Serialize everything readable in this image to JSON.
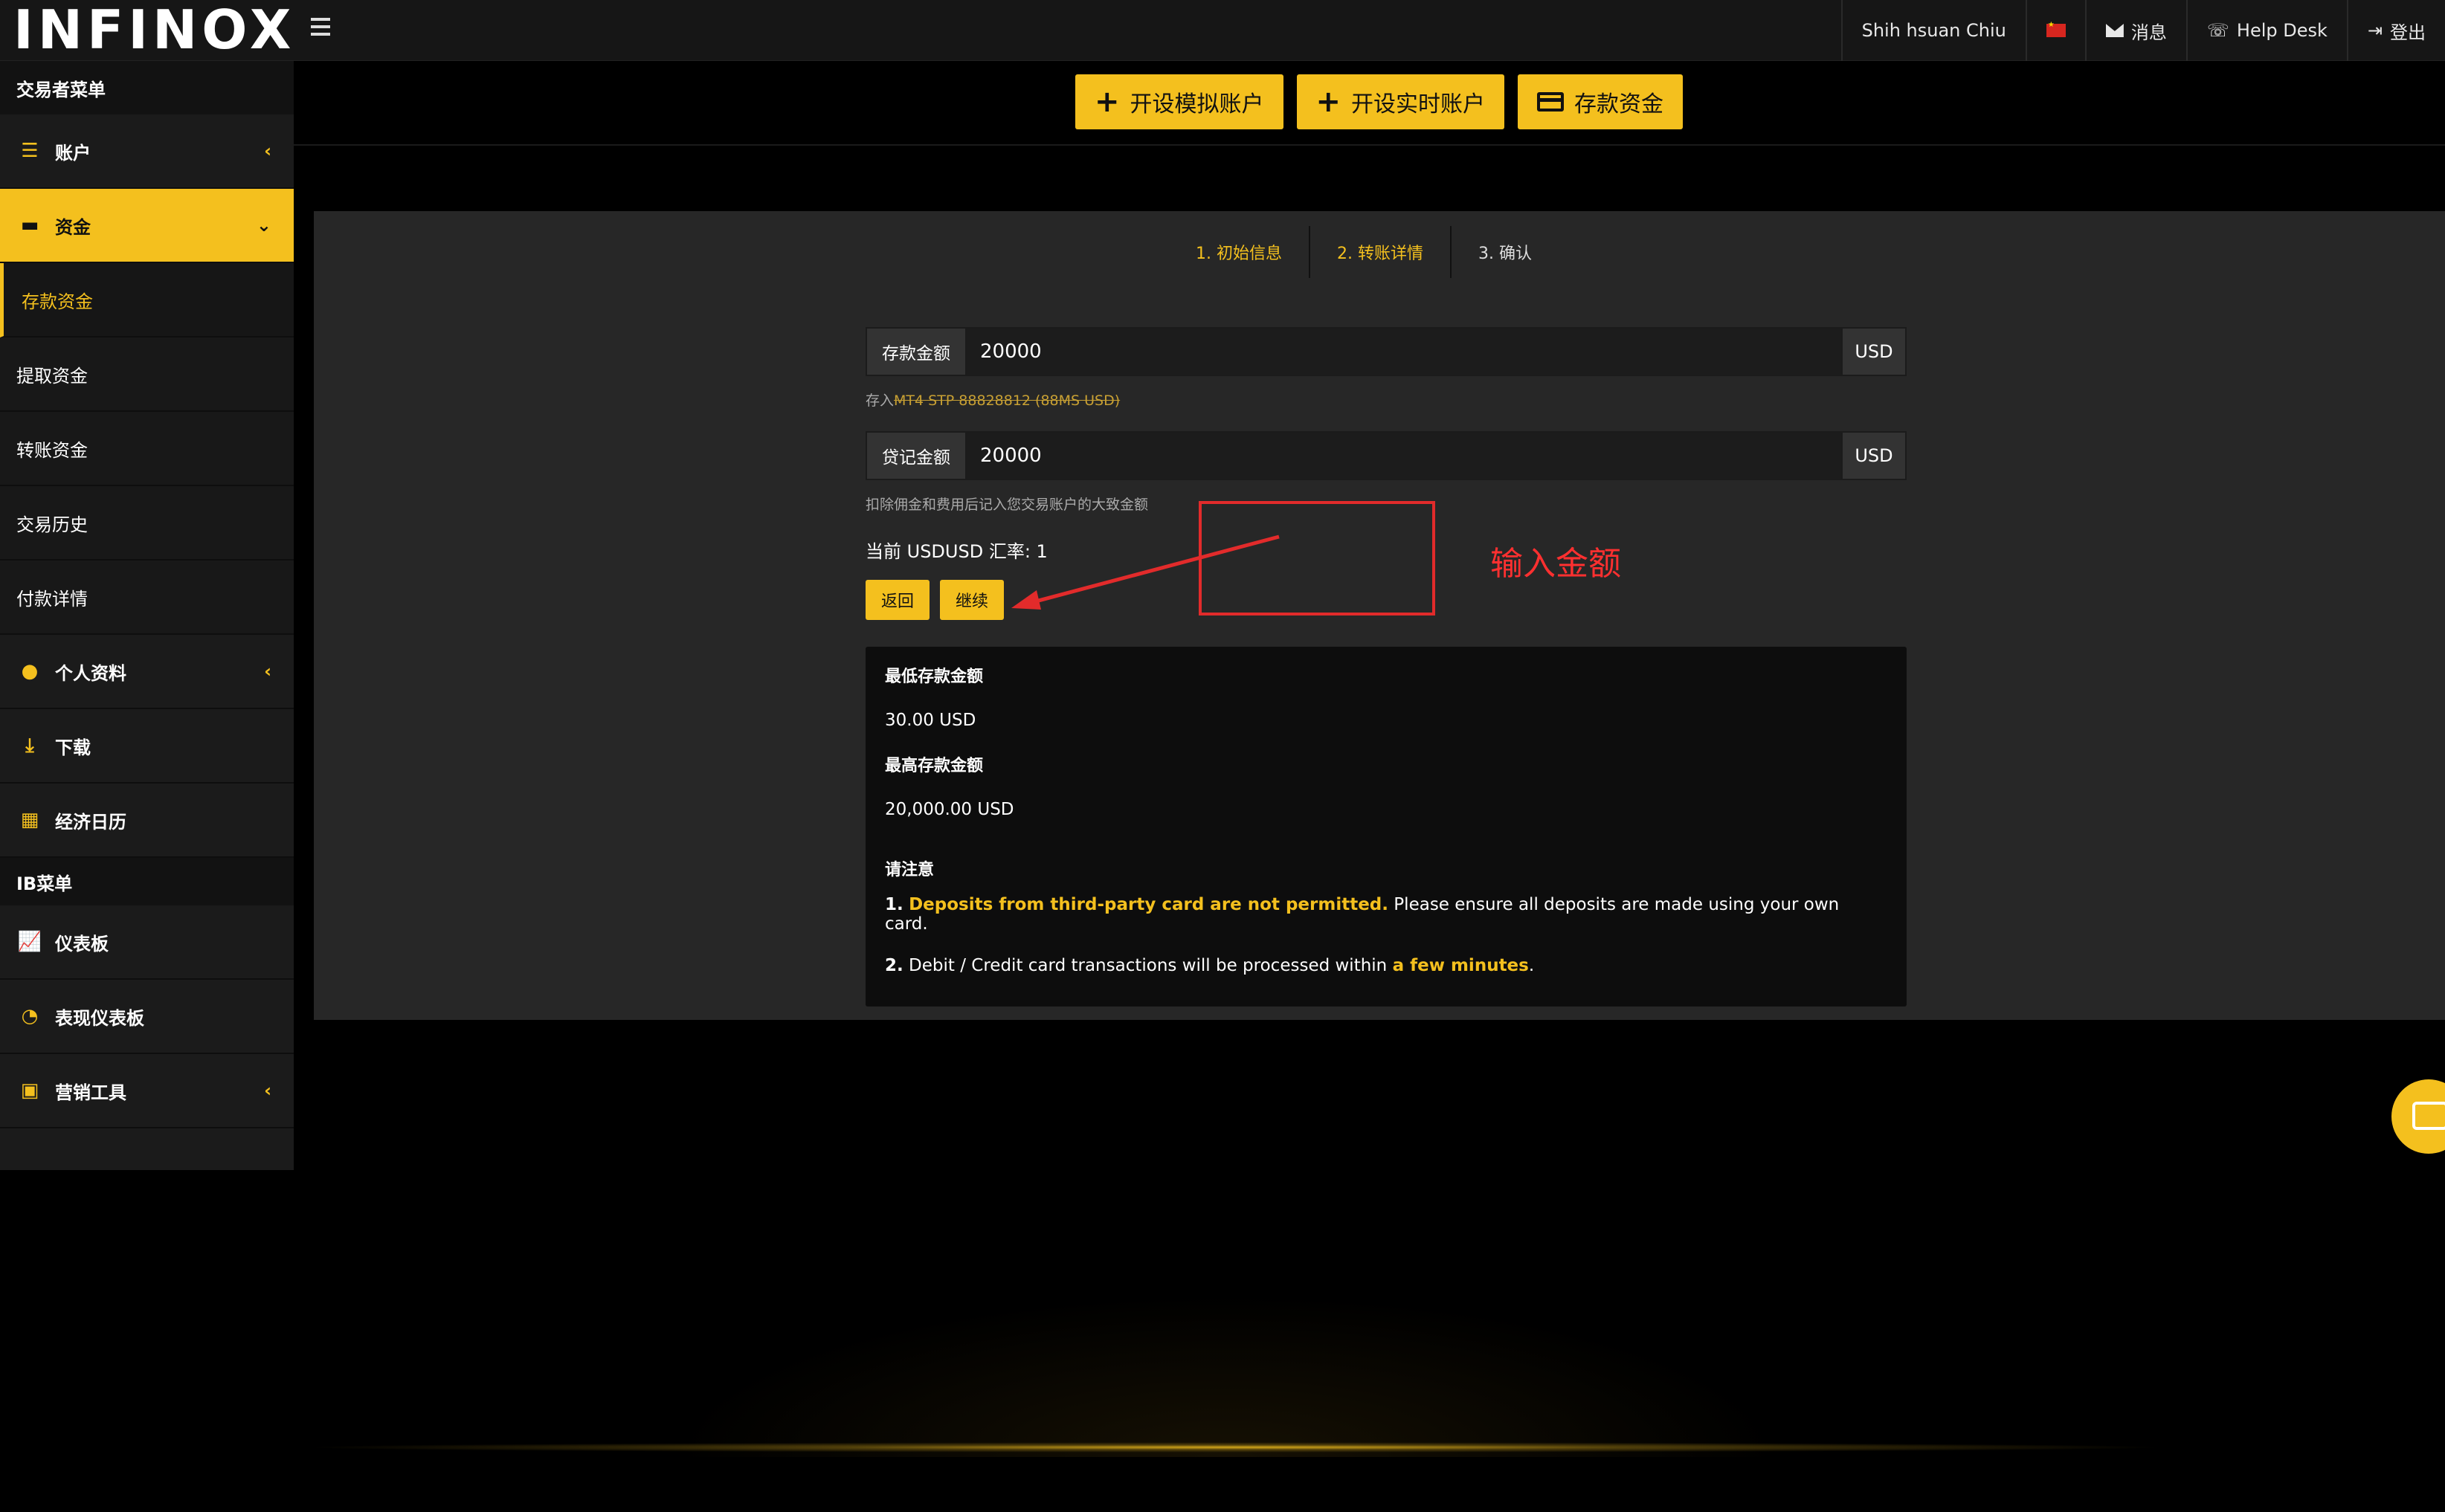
{
  "brand": {
    "logo_text": "INFINOX"
  },
  "topbar": {
    "user": "Shih hsuan Chiu",
    "messages": "消息",
    "help": "Help Desk",
    "logout": "登出"
  },
  "sidebar": {
    "trader_menu": "交易者菜单",
    "items": {
      "account": "账户",
      "funds": "资金",
      "deposit": "存款资金",
      "withdraw": "提取资金",
      "transfer": "转账资金",
      "history": "交易历史",
      "payment": "付款详情",
      "profile": "个人资料",
      "download": "下载",
      "calendar": "经济日历"
    },
    "ib_menu": "IB菜单",
    "ib_items": {
      "dashboard": "仪表板",
      "perf": "表现仪表板",
      "marketing": "营销工具"
    }
  },
  "actions": {
    "demo": "开设模拟账户",
    "live": "开设实时账户",
    "deposit": "存款资金"
  },
  "steps": [
    "1. 初始信息",
    "2. 转账详情",
    "3. 确认"
  ],
  "form": {
    "deposit_label": "存款金额",
    "deposit_value": "20000",
    "currency": "USD",
    "deposit_to_prefix": "存入",
    "deposit_to_account": "MT4 STP 88828812 (88MS USD)",
    "credit_label": "贷记金额",
    "credit_value": "20000",
    "credit_hint": "扣除佣金和费用后记入您交易账户的大致金额",
    "rate": "当前 USDUSD 汇率: 1",
    "back": "返回",
    "continue": "继续"
  },
  "annotation": {
    "text": "输入金额"
  },
  "info": {
    "min_title": "最低存款金额",
    "min_value": "30.00 USD",
    "max_title": "最高存款金额",
    "max_value": "20,000.00 USD",
    "note_title": "请注意",
    "note1_num": "1.",
    "note1_hl": "Deposits from third-party card are not permitted.",
    "note1_rest": " Please ensure all deposits are made using your own card.",
    "note2_num": "2.",
    "note2_text": " Debit / Credit card transactions will be processed within ",
    "note2_hl": "a few minutes",
    "note2_end": "."
  },
  "colors": {
    "accent": "#f4c01e",
    "annotation": "#e22b2b"
  }
}
